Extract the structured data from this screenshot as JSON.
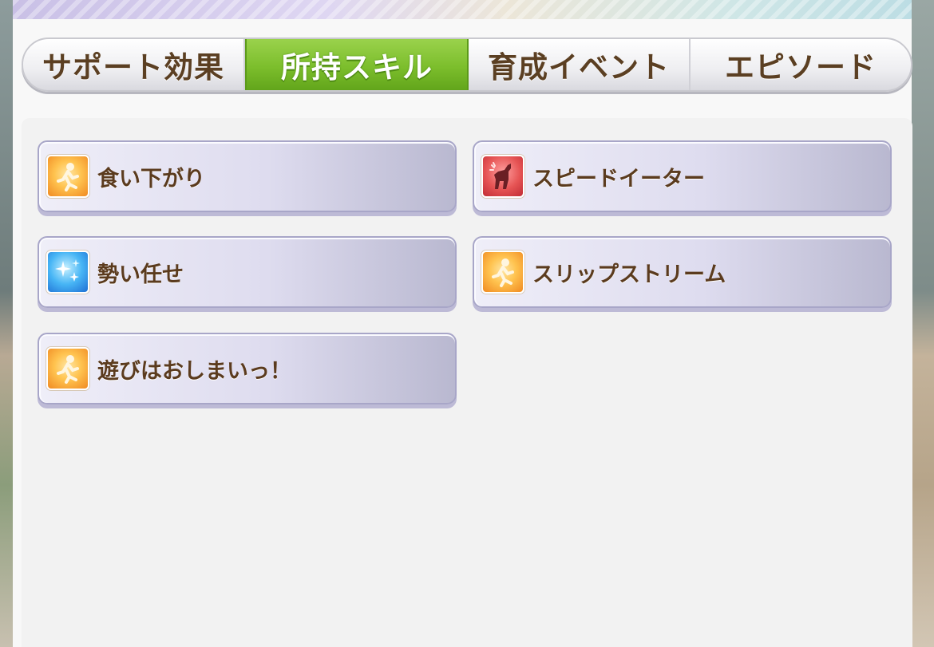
{
  "tabs": [
    {
      "label": "サポート効果",
      "active": false
    },
    {
      "label": "所持スキル",
      "active": true
    },
    {
      "label": "育成イベント",
      "active": false
    },
    {
      "label": "エピソード",
      "active": false
    }
  ],
  "skills": [
    {
      "name": "食い下がり",
      "icon": "running-figure-icon",
      "color": "orange"
    },
    {
      "name": "スピードイーター",
      "icon": "horse-silhouette-icon",
      "color": "red"
    },
    {
      "name": "勢い任せ",
      "icon": "sparkle-icon",
      "color": "blue"
    },
    {
      "name": "スリップストリーム",
      "icon": "running-figure-icon",
      "color": "orange"
    },
    {
      "name": "遊びはおしまいっ！",
      "icon": "running-figure-icon",
      "color": "orange"
    }
  ],
  "colors": {
    "active_tab": "#7cbe2c",
    "label_text": "#5b3b1e",
    "skill_orange": "#f5a53a",
    "skill_blue": "#47b5f5",
    "skill_red": "#e65454"
  }
}
